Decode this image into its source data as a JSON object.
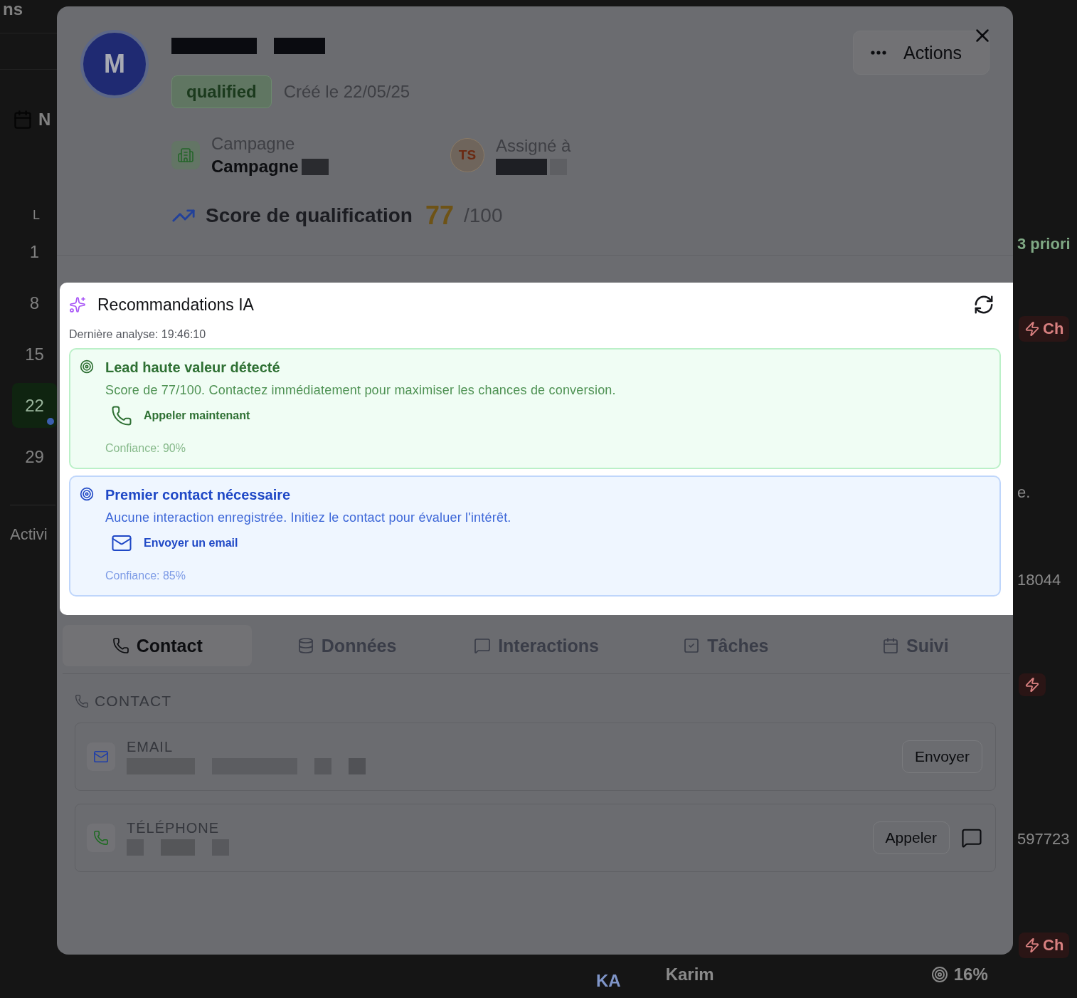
{
  "background": {
    "title_fragment": "ns",
    "calendar": {
      "title_fragment": "N",
      "weekday": "L",
      "days": [
        {
          "label": "1",
          "selected": false
        },
        {
          "label": "8",
          "selected": false
        },
        {
          "label": "15",
          "selected": false
        },
        {
          "label": "22",
          "selected": true
        },
        {
          "label": "29",
          "selected": false
        }
      ]
    },
    "activity_fragment": "Activi",
    "right_items": [
      {
        "kind": "text",
        "text": "3 priori"
      },
      {
        "kind": "badge",
        "text": "Ch"
      },
      {
        "kind": "text",
        "text": "e."
      },
      {
        "kind": "text",
        "text": "18044"
      },
      {
        "kind": "icon-badge"
      },
      {
        "kind": "text",
        "text": "597723"
      },
      {
        "kind": "badge",
        "text": "Ch"
      }
    ],
    "bottom_row": {
      "avatar": "KA",
      "name": "Karim",
      "score": "16%"
    }
  },
  "lead": {
    "avatar": "M",
    "status": "qualified",
    "created": "Créé le 22/05/25",
    "campaign": {
      "label": "Campagne",
      "value": "Campagne"
    },
    "assignee": {
      "initials": "TS",
      "label": "Assigné à"
    },
    "score": {
      "label": "Score de qualification",
      "value": "77",
      "max": "/100"
    },
    "actions_label": "Actions"
  },
  "ai": {
    "title": "Recommandations IA",
    "last_analysis": "Dernière analyse: 19:46:10",
    "items": [
      {
        "kind": "success",
        "title": "Lead haute valeur détecté",
        "description": "Score de 77/100. Contactez immédiatement pour maximiser les chances de conversion.",
        "action": {
          "kind": "call",
          "label": "Appeler maintenant"
        },
        "confidence": "Confiance: 90%"
      },
      {
        "kind": "info",
        "title": "Premier contact nécessaire",
        "description": "Aucune interaction enregistrée. Initiez le contact pour évaluer l'intérêt.",
        "action": {
          "kind": "email",
          "label": "Envoyer un email"
        },
        "confidence": "Confiance: 85%"
      }
    ]
  },
  "tabs": [
    {
      "label": "Contact",
      "selected": true
    },
    {
      "label": "Données",
      "selected": false
    },
    {
      "label": "Interactions",
      "selected": false
    },
    {
      "label": "Tâches",
      "selected": false
    },
    {
      "label": "Suivi",
      "selected": false
    }
  ],
  "contact": {
    "heading": "CONTACT",
    "fields": [
      {
        "kind": "email",
        "label": "EMAIL",
        "button": "Envoyer"
      },
      {
        "kind": "phone",
        "label": "TÉLÉPHONE",
        "button": "Appeler"
      }
    ]
  }
}
